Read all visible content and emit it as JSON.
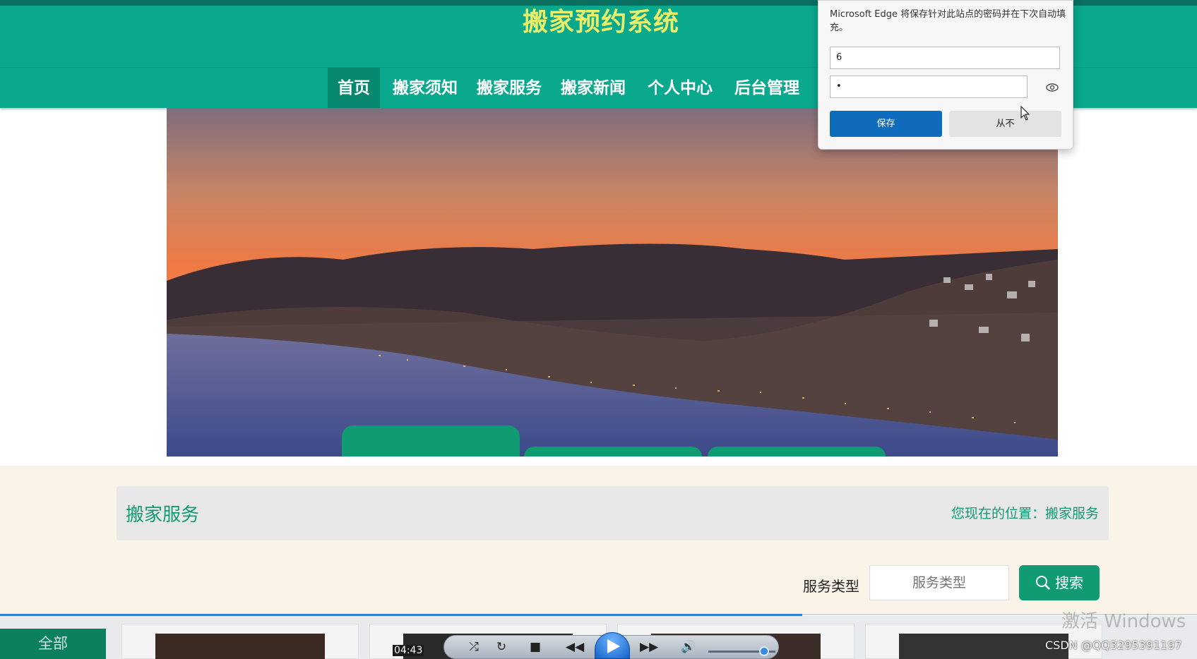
{
  "site": {
    "title": "搬家预约系统"
  },
  "nav": {
    "items": [
      {
        "label": "首页"
      },
      {
        "label": "搬家须知"
      },
      {
        "label": "搬家服务"
      },
      {
        "label": "搬家新闻"
      },
      {
        "label": "个人中心"
      },
      {
        "label": "后台管理"
      }
    ],
    "active": "首页"
  },
  "breadcrumb": {
    "title": "搬家服务",
    "position_text": "您现在的位置：搬家服务"
  },
  "search": {
    "label": "服务类型",
    "placeholder": "服务类型",
    "button_label": "搜索"
  },
  "password_popup": {
    "message": "Microsoft Edge 将保存针对此站点的密码并在下次自动填充。",
    "username_value": "6",
    "password_value": "•",
    "save_label": "保存",
    "never_label": "从不"
  },
  "player": {
    "category_tab": "全部",
    "time": "04:43",
    "progress_fraction": 0.67
  },
  "overlay": {
    "activation_watermark": "激活 Windows",
    "attribution": "CSDN @QQ3295391197"
  },
  "colors": {
    "primary": "#0aa88c",
    "accent_green": "#119b73",
    "title_yellow": "#e8f06b",
    "edge_blue": "#0f6cbd"
  }
}
